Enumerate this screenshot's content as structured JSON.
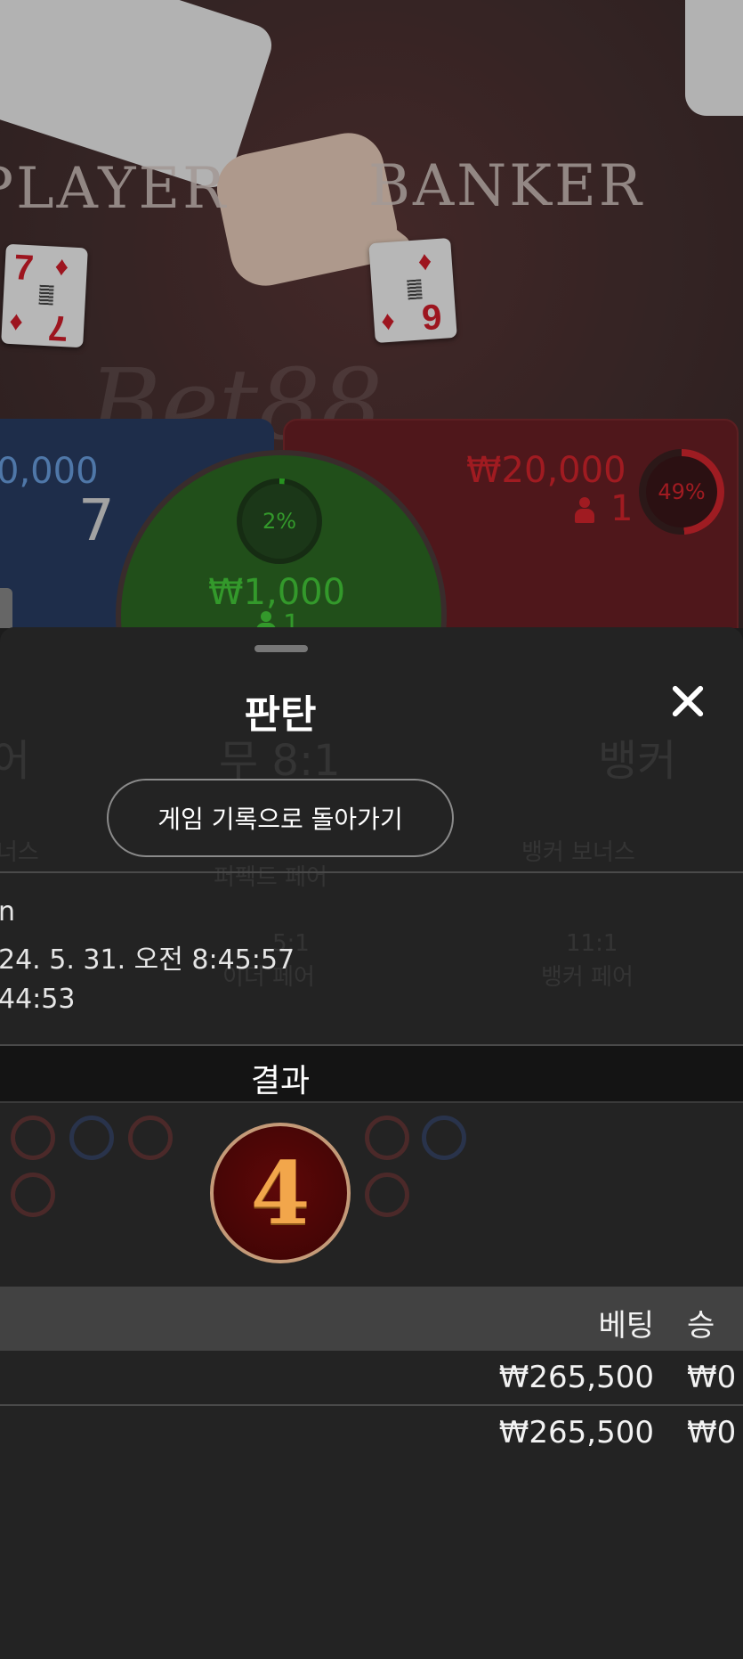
{
  "table": {
    "player_label": "PLAYER",
    "banker_label": "BANKER",
    "watermark": "Bet88",
    "player_card": {
      "rank": "7",
      "suit": "♦"
    },
    "banker_card": {
      "rank": "9",
      "suit": "♦"
    },
    "player": {
      "amount": "0,000",
      "total": "7"
    },
    "banker": {
      "amount": "₩20,000",
      "players": "1",
      "percent": "49%"
    },
    "tie": {
      "amount": "₩1,000",
      "players": "1",
      "percent": "2%"
    }
  },
  "sheet": {
    "title": "판탄",
    "back_button": "게임 기록으로 돌아가기",
    "info_lines": [
      "n",
      "24. 5. 31. 오전 8:45:57",
      "44:53"
    ],
    "result_label": "결과",
    "result_value": "4",
    "columns": {
      "bet": "베팅",
      "win": "승"
    },
    "rows": [
      {
        "bet": "₩265,500",
        "win": "₩0"
      },
      {
        "bet": "₩265,500",
        "win": "₩0"
      }
    ]
  },
  "background_ghost": {
    "player": "어",
    "tie": "무 8:1",
    "banker": "뱅커",
    "player_bonus": "너스",
    "perfect_pair": "퍼펙트 페어",
    "banker_bonus": "뱅커 보너스",
    "either_pair_odds": "5:1",
    "either_pair": "이더 페어",
    "banker_pair_odds": "11:1",
    "banker_pair": "뱅커 페어"
  },
  "colors": {
    "player": "#283d63",
    "banker": "#6a1f24",
    "tie": "#2d6a23",
    "badge_gold": "#f2a64b"
  }
}
